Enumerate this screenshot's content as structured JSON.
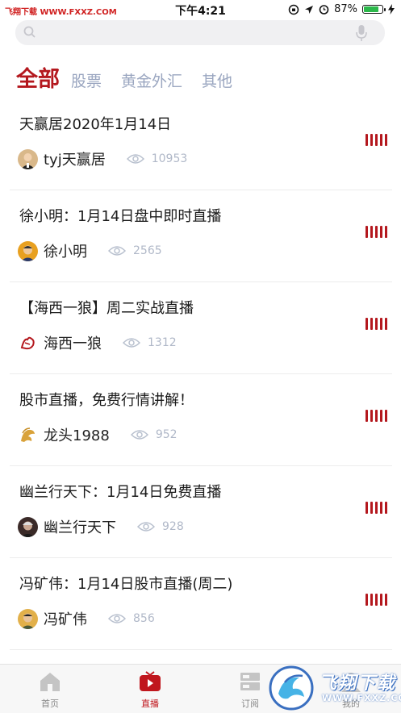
{
  "status_bar": {
    "carrier": "飞翔下载 WWW.FXXZ.COM",
    "time": "下午4:21",
    "battery": "87%",
    "battery_level": 0.87
  },
  "search": {
    "placeholder": ""
  },
  "tabs": [
    {
      "label": "全部",
      "active": true
    },
    {
      "label": "股票",
      "active": false
    },
    {
      "label": "黄金外汇",
      "active": false
    },
    {
      "label": "其他",
      "active": false
    }
  ],
  "items": [
    {
      "title": "天赢居2020年1月14日",
      "author": "tyj天赢居",
      "views": "10953"
    },
    {
      "title": "徐小明：1月14日盘中即时直播",
      "author": "徐小明",
      "views": "2565"
    },
    {
      "title": "【海西一狼】周二实战直播",
      "author": "海西一狼",
      "views": "1312"
    },
    {
      "title": "股市直播，免费行情讲解！",
      "author": "龙头1988",
      "views": "952"
    },
    {
      "title": "幽兰行天下：1月14日免费直播",
      "author": "幽兰行天下",
      "views": "928"
    },
    {
      "title": "冯矿伟：1月14日股市直播(周二)",
      "author": "冯矿伟",
      "views": "856"
    }
  ],
  "bottom_nav": [
    {
      "label": "首页",
      "icon": "home-icon",
      "active": false
    },
    {
      "label": "直播",
      "icon": "tv-play-icon",
      "active": true
    },
    {
      "label": "订阅",
      "icon": "subscribe-icon",
      "active": false
    },
    {
      "label": "我的",
      "icon": "profile-icon",
      "active": false
    }
  ],
  "watermark": {
    "text": "飞翔下载",
    "sub": "WWW.FXXZ.COM"
  },
  "colors": {
    "accent": "#b4181e",
    "inactive_tab": "#9aa6c0",
    "view_count": "#b0b8c8"
  }
}
